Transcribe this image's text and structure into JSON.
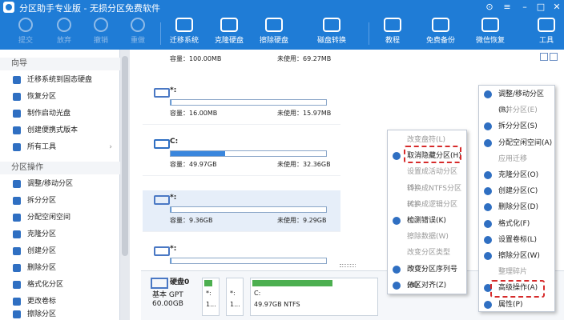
{
  "window": {
    "title": "分区助手专业版 - 无损分区免费软件"
  },
  "toolbar": {
    "submit": "提交",
    "discard": "放弃",
    "undo": "撤销",
    "redo": "重做",
    "migrate": "迁移系统",
    "clone_disk": "克隆硬盘",
    "wipe_disk": "擦除硬盘",
    "disk_convert": "磁盘转换",
    "tutorial": "教程",
    "free_backup": "免费备份",
    "wechat_restore": "微信恢复",
    "tools": "工具"
  },
  "sidebar": {
    "wizard_title": "向导",
    "wizard_items": [
      "迁移系统到固态硬盘",
      "恢复分区",
      "制作启动光盘",
      "创建便携式版本",
      "所有工具"
    ],
    "ops_title": "分区操作",
    "ops_items": [
      "调整/移动分区",
      "拆分分区",
      "分配空闲空间",
      "克隆分区",
      "创建分区",
      "删除分区",
      "格式化分区",
      "更改卷标",
      "擦除分区"
    ]
  },
  "partitions": [
    {
      "label": "*:",
      "capacity": "容量：16.00MB",
      "free": "未使用：15.97MB",
      "used_fraction": 0.003
    },
    {
      "label": "C:",
      "capacity": "容量：49.97GB",
      "free": "未使用：32.36GB",
      "used_fraction": 0.35
    },
    {
      "label": "*:",
      "capacity": "容量：9.36GB",
      "free": "未使用：9.29GB",
      "used_fraction": 0.007
    },
    {
      "label": "*:",
      "capacity": "",
      "free": "",
      "used_fraction": 0.0
    }
  ],
  "top_partition": {
    "capacity": "容量：100.00MB",
    "free": "未使用：69.27MB"
  },
  "disk": {
    "name": "硬盘0",
    "type": "基本 GPT",
    "size": "60.00GB",
    "parts": [
      {
        "label": "*:",
        "cap": "1..."
      },
      {
        "label": "*:",
        "cap": "1..."
      },
      {
        "label": "C:",
        "cap": "49.97GB NTFS"
      }
    ]
  },
  "context_menu_advanced": [
    {
      "label": "改变盘符(L)",
      "enabled": false
    },
    {
      "label": "取消隐藏分区(H)",
      "enabled": true
    },
    {
      "label": "设置成活动分区(S)",
      "enabled": false
    },
    {
      "label": "转换成NTFS分区(C)",
      "enabled": false
    },
    {
      "label": "转换成逻辑分区(G)",
      "enabled": false
    },
    {
      "label": "检测错误(K)",
      "enabled": true
    },
    {
      "label": "擦除数据(W)",
      "enabled": false
    },
    {
      "label": "改变分区类型ID(T)",
      "enabled": false
    },
    {
      "label": "改变分区序列号(N)",
      "enabled": true
    },
    {
      "label": "分区对齐(Z)",
      "enabled": true
    }
  ],
  "context_menu_main": [
    {
      "label": "调整/移动分区(R)",
      "enabled": true
    },
    {
      "label": "合并分区(E)",
      "enabled": false
    },
    {
      "label": "拆分分区(S)",
      "enabled": true
    },
    {
      "label": "分配空闲空间(A)",
      "enabled": true
    },
    {
      "label": "应用迁移",
      "enabled": false
    },
    {
      "label": "克隆分区(O)",
      "enabled": true
    },
    {
      "label": "创建分区(C)",
      "enabled": true
    },
    {
      "label": "删除分区(D)",
      "enabled": true
    },
    {
      "label": "格式化(F)",
      "enabled": true
    },
    {
      "label": "设置卷标(L)",
      "enabled": true
    },
    {
      "label": "擦除分区(W)",
      "enabled": true
    },
    {
      "label": "整理碎片",
      "enabled": false
    },
    {
      "label": "高级操作(A)",
      "enabled": true
    },
    {
      "label": "属性(P)",
      "enabled": true
    }
  ],
  "colors": {
    "accent": "#1f7cd6",
    "highlight": "#d62b2b"
  }
}
